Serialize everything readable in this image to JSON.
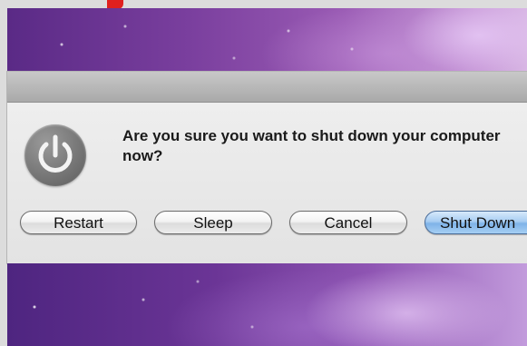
{
  "dialog": {
    "message": "Are you sure you want to shut down your computer now?",
    "icon": "power-icon",
    "buttons": {
      "restart": "Restart",
      "sleep": "Sleep",
      "cancel": "Cancel",
      "shut_down": "Shut Down"
    },
    "default_button_color": "#8fc0ee"
  },
  "colors": {
    "wallpaper_primary": "#6b3596",
    "wallpaper_highlight": "#d8b6e4",
    "accent_mark": "#e0201e"
  }
}
